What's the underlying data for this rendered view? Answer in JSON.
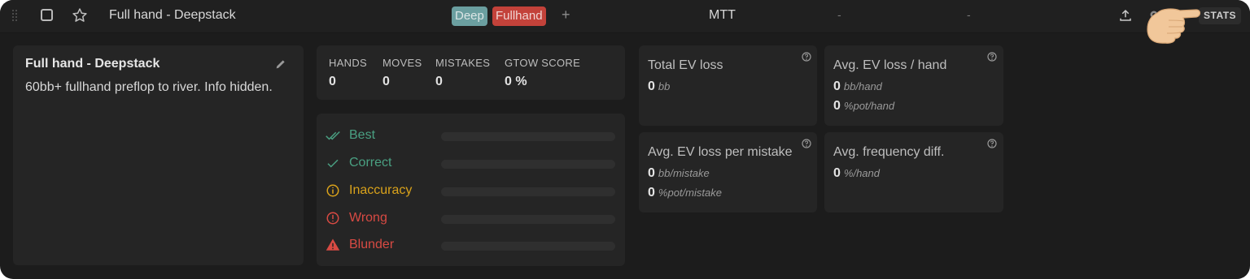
{
  "header": {
    "title": "Full hand - Deepstack",
    "tags": [
      "Deep",
      "Fullhand"
    ],
    "add_tag": "+",
    "format": "MTT",
    "field1": "-",
    "field2": "-",
    "stats_button": "STATS"
  },
  "info": {
    "title": "Full hand - Deepstack",
    "description": "60bb+ fullhand preflop to river. Info hidden."
  },
  "counts": [
    {
      "label": "HANDS",
      "value": "0"
    },
    {
      "label": "MOVES",
      "value": "0"
    },
    {
      "label": "MISTAKES",
      "value": "0"
    },
    {
      "label": "GTOW SCORE",
      "value": "0 %"
    }
  ],
  "grades": [
    {
      "label": "Best",
      "color": "#4aa082",
      "icon": "double-check-icon",
      "fraction": 0
    },
    {
      "label": "Correct",
      "color": "#4aa082",
      "icon": "check-icon",
      "fraction": 0
    },
    {
      "label": "Inaccuracy",
      "color": "#d9a21b",
      "icon": "info-circle-icon",
      "fraction": 0
    },
    {
      "label": "Wrong",
      "color": "#d84a43",
      "icon": "alert-circle-icon",
      "fraction": 0
    },
    {
      "label": "Blunder",
      "color": "#d84a43",
      "icon": "warning-triangle-icon",
      "fraction": 0
    }
  ],
  "stats": {
    "total_ev_loss": {
      "label": "Total EV loss",
      "value": "0",
      "unit": "bb"
    },
    "avg_ev_loss_hand": {
      "label": "Avg. EV loss / hand",
      "value1": "0",
      "unit1": "bb/hand",
      "value2": "0",
      "unit2": "%pot/hand"
    },
    "avg_ev_loss_mistake": {
      "label": "Avg. EV loss per mistake",
      "value1": "0",
      "unit1": "bb/mistake",
      "value2": "0",
      "unit2": "%pot/mistake"
    },
    "avg_freq_diff": {
      "label": "Avg. frequency diff.",
      "value": "0",
      "unit": "%/hand"
    }
  }
}
